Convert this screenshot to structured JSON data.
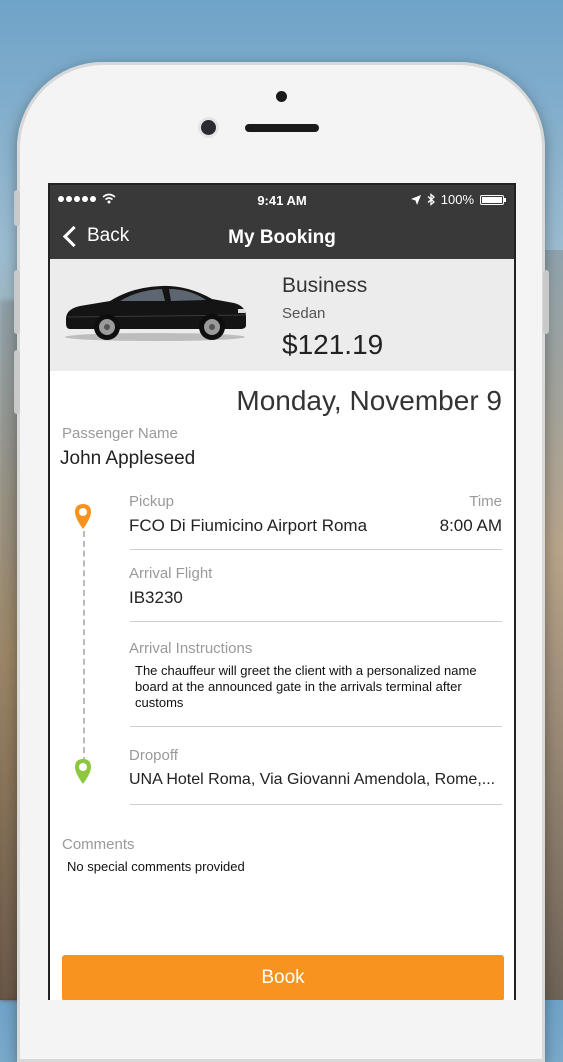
{
  "status_bar": {
    "time": "9:41 AM",
    "battery": "100%"
  },
  "nav": {
    "back_label": "Back",
    "title": "My Booking"
  },
  "vehicle": {
    "class": "Business",
    "type": "Sedan",
    "price": "$121.19"
  },
  "booking": {
    "date": "Monday, November 9",
    "passenger_label": "Passenger Name",
    "passenger_name": "John Appleseed",
    "pickup_label": "Pickup",
    "pickup_value": "FCO Di Fiumicino Airport Roma",
    "time_label": "Time",
    "time_value": "8:00 AM",
    "flight_label": "Arrival Flight",
    "flight_value": "IB3230",
    "instructions_label": "Arrival Instructions",
    "instructions_value": "The chauffeur will greet the client with a personalized name board at the announced gate in the arrivals terminal after customs",
    "dropoff_label": "Dropoff",
    "dropoff_value": "UNA Hotel Roma, Via Giovanni Amendola, Rome,...",
    "comments_label": "Comments",
    "comments_value": "No special comments provided"
  },
  "actions": {
    "book_label": "Book"
  },
  "colors": {
    "accent": "#f7931e",
    "pickup_pin": "#f7931e",
    "dropoff_pin": "#8dc63f",
    "nav_bg": "#393939"
  },
  "icons": {
    "back": "chevron-left-icon",
    "pickup": "map-pin-icon",
    "dropoff": "map-pin-icon",
    "location": "location-arrow-icon",
    "bluetooth": "bluetooth-icon",
    "wifi": "wifi-icon",
    "battery": "battery-icon"
  }
}
